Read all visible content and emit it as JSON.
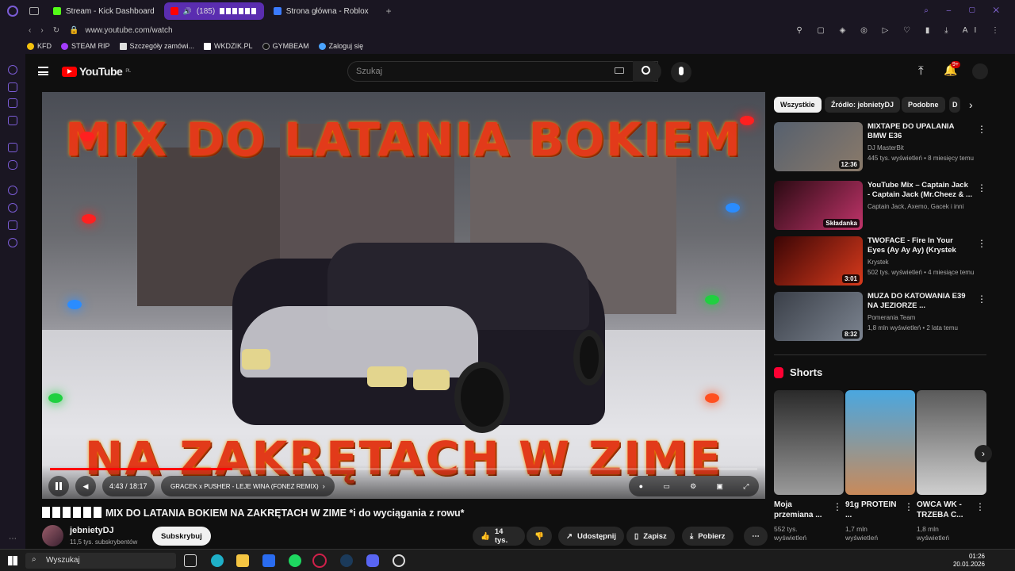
{
  "browser": {
    "tabs": [
      {
        "label": "Stream - Kick Dashboard",
        "color": "#53fc18"
      },
      {
        "label": "(185)",
        "color": "#ff0000"
      },
      {
        "label": "Strona główna - Roblox",
        "color": "#3b7bff"
      }
    ],
    "url": "www.youtube.com/watch",
    "bookmarks": [
      "KFD",
      "STEAM RIP",
      "Szczegóły zamówi...",
      "WKDZIK.PL",
      "GYMBEAM",
      "Zaloguj się"
    ]
  },
  "header": {
    "logo_text": "YouTube",
    "region": "PL",
    "search_placeholder": "Szukaj",
    "notif_count": "9+"
  },
  "player": {
    "overlay_top": "MIX DO LATANIA BOKIEM",
    "overlay_bottom": "NA ZAKRĘTACH W ZIME",
    "time": "4:43 / 18:17",
    "chapter": "GRACEK x PUSHER - LEJE WINA (FONEZ REMIX)",
    "progress": 0.258
  },
  "video": {
    "title": "MIX DO LATANIA BOKIEM NA ZAKRĘTACH W ZIME *i do wyciągania z rowu*",
    "channel": "jebnietyDJ",
    "subs": "11,5 tys. subskrybentów",
    "subscribe": "Subskrybuj",
    "likes": "14 tys.",
    "share": "Udostępnij",
    "save": "Zapisz",
    "download": "Pobierz"
  },
  "chips": [
    "Wszystkie",
    "Źródło: jebnietyDJ",
    "Podobne",
    "D"
  ],
  "recommendations": [
    {
      "title": "MIXTAPE DO UPALANIA BMW E36",
      "channel": "DJ MasterBit",
      "meta": "445 tys. wyświetleń • 8 miesięcy temu",
      "duration": "12:36",
      "colors": [
        "#56606e",
        "#8a7a6a"
      ]
    },
    {
      "title": "YouTube Mix – Captain Jack - Captain Jack (Mr.Cheez & ...",
      "channel": "Captain Jack, Axemo, Gacek i inni",
      "meta": "",
      "duration": "Składanka",
      "colors": [
        "#2a0a12",
        "#c0346a"
      ]
    },
    {
      "title": "TWOFACE - Fire In Your Eyes (Ay Ay Ay) (Krystek Remix)",
      "channel": "Krystek",
      "meta": "502 tys. wyświetleń • 4 miesiące temu",
      "duration": "3:01",
      "colors": [
        "#3a0505",
        "#d83a1c"
      ]
    },
    {
      "title": "MUZA DO KATOWANIA E39 NA JEZIORZE ...",
      "channel": "Pomerania Team",
      "meta": "1,8 mln wyświetleń • 2 lata temu",
      "duration": "8:32",
      "colors": [
        "#3a3f48",
        "#7c8490"
      ]
    }
  ],
  "shorts": {
    "heading": "Shorts",
    "items": [
      {
        "title": "Moja przemiana ...",
        "views": "552 tys. wyświetleń",
        "colors": [
          "#2a2a2a",
          "#9a9a9a"
        ]
      },
      {
        "title": "91g PROTEIN ...",
        "views": "1,7 mln wyświetleń",
        "colors": [
          "#4aa7e0",
          "#c98a5a"
        ]
      },
      {
        "title": "OWCA WK - TRZEBA C...",
        "views": "1,8 mln wyświetleń",
        "colors": [
          "#5a5a5a",
          "#cfcfcf"
        ]
      }
    ]
  },
  "taskbar": {
    "search": "Wyszukaj",
    "time": "01:26",
    "date": "20.01.2026"
  }
}
